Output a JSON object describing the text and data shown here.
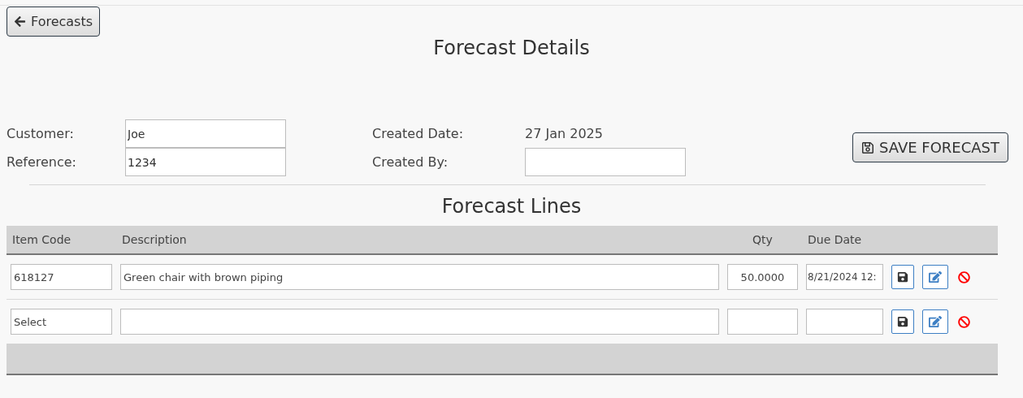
{
  "back_button": {
    "label": "Forecasts"
  },
  "title": "Forecast Details",
  "form": {
    "left": [
      {
        "label": "Customer:",
        "value": "Joe"
      },
      {
        "label": "Reference:",
        "value": "1234"
      }
    ],
    "created_date": {
      "label": "Created Date:",
      "value": "27 Jan 2025"
    },
    "created_by": {
      "label": "Created By:"
    }
  },
  "save_button": {
    "label": "SAVE FORECAST"
  },
  "lines_title": "Forecast Lines",
  "table": {
    "columns": [
      "Item Code",
      "Description",
      "Qty",
      "Due Date"
    ],
    "rows": [
      {
        "item_code": "618127",
        "description": "Green chair with brown piping",
        "qty": "50.0000",
        "due_date": "8/21/2024 12:"
      },
      {
        "item_code": "Select"
      }
    ]
  }
}
